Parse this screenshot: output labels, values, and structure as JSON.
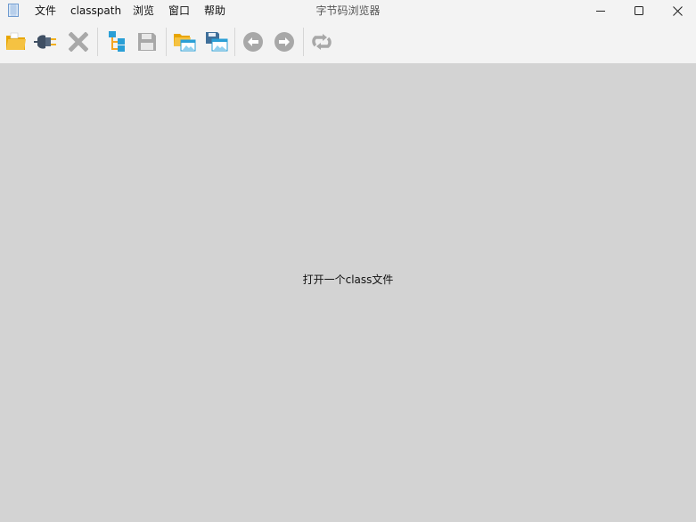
{
  "window": {
    "title": "字节码浏览器"
  },
  "menu": {
    "file": "文件",
    "classpath": "classpath",
    "browse": "浏览",
    "window": "窗口",
    "help": "帮助"
  },
  "window_controls": {
    "icons": [
      "minimize-icon",
      "maximize-icon",
      "close-icon"
    ]
  },
  "toolbar": {
    "icons": [
      "open-folder-icon",
      "plug-icon",
      "close-x-icon",
      "tree-icon",
      "save-disk-icon",
      "open-window-folder-icon",
      "save-window-icon",
      "back-arrow-icon",
      "forward-arrow-icon",
      "refresh-icon"
    ],
    "disabled": [
      "close-x-icon",
      "save-disk-icon",
      "back-arrow-icon",
      "forward-arrow-icon",
      "refresh-icon"
    ]
  },
  "content": {
    "hint": "打开一个class文件"
  },
  "colors": {
    "chrome_bg": "#f3f3f3",
    "content_bg": "#d3d3d3",
    "folder_yellow": "#f5c242",
    "accent_blue": "#2a9fd6",
    "disabled_gray": "#a8a8a8"
  }
}
